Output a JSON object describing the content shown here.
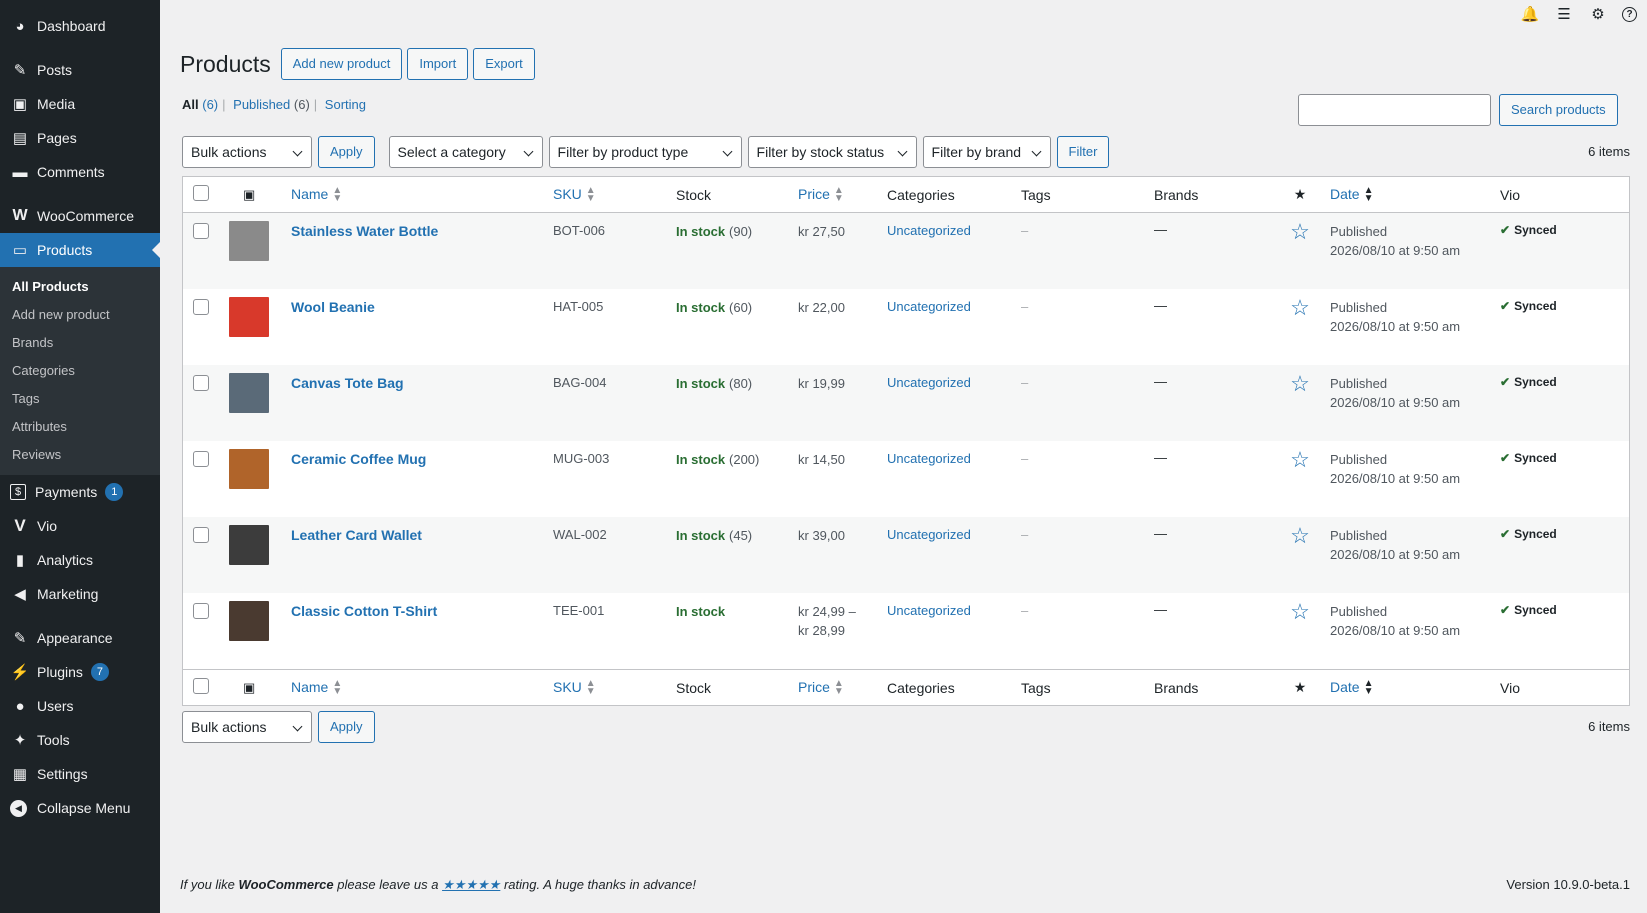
{
  "sidebar": {
    "top_items": [
      {
        "label": "Dashboard",
        "icon": "dashboard-icon",
        "glyph": "◕"
      },
      {
        "label": "Posts",
        "icon": "pin-icon",
        "glyph": "✎"
      },
      {
        "label": "Media",
        "icon": "media-icon",
        "glyph": "▣"
      },
      {
        "label": "Pages",
        "icon": "pages-icon",
        "glyph": "▤"
      },
      {
        "label": "Comments",
        "icon": "comment-icon",
        "glyph": "▬"
      }
    ],
    "woo": {
      "label": "WooCommerce",
      "glyph": "W"
    },
    "products": {
      "label": "Products",
      "glyph": "▭"
    },
    "submenu": [
      "All Products",
      "Add new product",
      "Brands",
      "Categories",
      "Tags",
      "Attributes",
      "Reviews"
    ],
    "payments": {
      "label": "Payments",
      "badge": "1",
      "glyph": "$"
    },
    "vio": {
      "label": "Vio",
      "glyph": "V"
    },
    "analytics": {
      "label": "Analytics",
      "glyph": "▮"
    },
    "marketing": {
      "label": "Marketing",
      "glyph": "◀"
    },
    "appearance": {
      "label": "Appearance",
      "glyph": "✎"
    },
    "plugins": {
      "label": "Plugins",
      "badge": "7",
      "glyph": "⚡"
    },
    "users": {
      "label": "Users",
      "glyph": "●"
    },
    "tools": {
      "label": "Tools",
      "glyph": "✦"
    },
    "settings": {
      "label": "Settings",
      "glyph": "▦"
    },
    "collapse": {
      "label": "Collapse Menu",
      "glyph": "◀"
    }
  },
  "topbar": {
    "icons": [
      "notification-icon",
      "list-icon",
      "gear-icon",
      "help-icon"
    ]
  },
  "header": {
    "title": "Products",
    "add_new": "Add new product",
    "import": "Import",
    "export": "Export"
  },
  "views": {
    "all": "All",
    "all_count": "(6)",
    "published": "Published",
    "published_count": "(6)",
    "sorting": "Sorting"
  },
  "search": {
    "button": "Search products",
    "value": ""
  },
  "filters": {
    "bulk_actions": "Bulk actions",
    "apply": "Apply",
    "category": "Select a category",
    "product_type": "Filter by product type",
    "stock_status": "Filter by stock status",
    "brand": "Filter by brand",
    "filter": "Filter",
    "items_count": "6 items"
  },
  "columns": {
    "name": "Name",
    "sku": "SKU",
    "stock": "Stock",
    "price": "Price",
    "categories": "Categories",
    "tags": "Tags",
    "brands": "Brands",
    "date": "Date",
    "vio": "Vio"
  },
  "products": [
    {
      "name": "Stainless Water Bottle",
      "sku": "BOT-006",
      "stock_status": "In stock",
      "stock_qty": "(90)",
      "price": "kr 27,50",
      "price2": "",
      "category": "Uncategorized",
      "tags": "–",
      "brands": "—",
      "date_status": "Published",
      "date": "2026/08/10 at 9:50 am",
      "vio": "Synced",
      "thumb_color": "#8a8a8a"
    },
    {
      "name": "Wool Beanie",
      "sku": "HAT-005",
      "stock_status": "In stock",
      "stock_qty": "(60)",
      "price": "kr 22,00",
      "price2": "",
      "category": "Uncategorized",
      "tags": "–",
      "brands": "—",
      "date_status": "Published",
      "date": "2026/08/10 at 9:50 am",
      "vio": "Synced",
      "thumb_color": "#d8392b"
    },
    {
      "name": "Canvas Tote Bag",
      "sku": "BAG-004",
      "stock_status": "In stock",
      "stock_qty": "(80)",
      "price": "kr 19,99",
      "price2": "",
      "category": "Uncategorized",
      "tags": "–",
      "brands": "—",
      "date_status": "Published",
      "date": "2026/08/10 at 9:50 am",
      "vio": "Synced",
      "thumb_color": "#5a6a78"
    },
    {
      "name": "Ceramic Coffee Mug",
      "sku": "MUG-003",
      "stock_status": "In stock",
      "stock_qty": "(200)",
      "price": "kr 14,50",
      "price2": "",
      "category": "Uncategorized",
      "tags": "–",
      "brands": "—",
      "date_status": "Published",
      "date": "2026/08/10 at 9:50 am",
      "vio": "Synced",
      "thumb_color": "#b0642a"
    },
    {
      "name": "Leather Card Wallet",
      "sku": "WAL-002",
      "stock_status": "In stock",
      "stock_qty": "(45)",
      "price": "kr 39,00",
      "price2": "",
      "category": "Uncategorized",
      "tags": "–",
      "brands": "—",
      "date_status": "Published",
      "date": "2026/08/10 at 9:50 am",
      "vio": "Synced",
      "thumb_color": "#3c3c3c"
    },
    {
      "name": "Classic Cotton T-Shirt",
      "sku": "TEE-001",
      "stock_status": "In stock",
      "stock_qty": "",
      "price": "kr 24,99 –",
      "price2": "kr 28,99",
      "category": "Uncategorized",
      "tags": "–",
      "brands": "—",
      "date_status": "Published",
      "date": "2026/08/10 at 9:50 am",
      "vio": "Synced",
      "thumb_color": "#4a3a30"
    }
  ],
  "footer": {
    "text1": "If you like ",
    "brand": "WooCommerce",
    "text2": " please leave us a ",
    "stars": "★★★★★",
    "text3": " rating. A huge thanks in advance!",
    "version": "Version 10.9.0-beta.1"
  }
}
